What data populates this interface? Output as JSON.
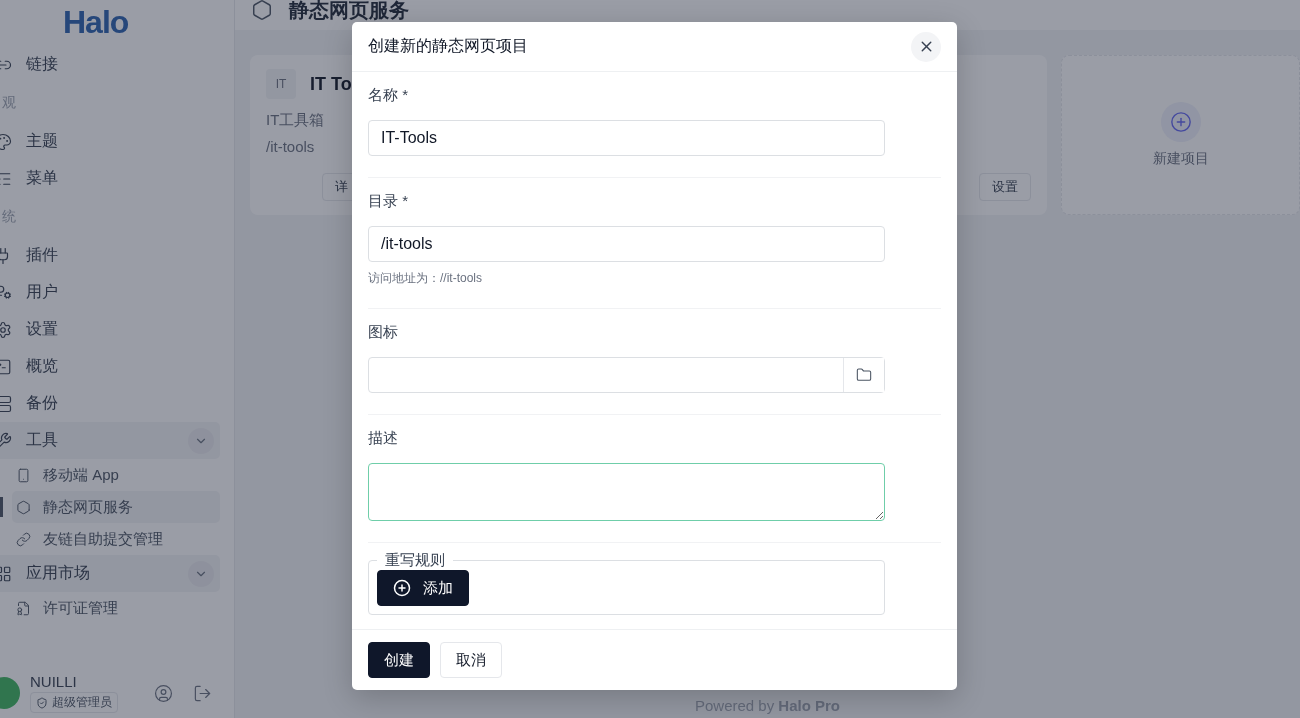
{
  "sidebar": {
    "logo": "Halo",
    "items": [
      {
        "kind": "item",
        "label": "链接"
      },
      {
        "kind": "group_label",
        "label": "观"
      },
      {
        "kind": "item",
        "label": "主题"
      },
      {
        "kind": "item",
        "label": "菜单"
      },
      {
        "kind": "group_label",
        "label": "统"
      },
      {
        "kind": "item",
        "label": "插件"
      },
      {
        "kind": "item",
        "label": "用户"
      },
      {
        "kind": "item",
        "label": "设置"
      },
      {
        "kind": "item",
        "label": "概览"
      },
      {
        "kind": "item",
        "label": "备份"
      },
      {
        "kind": "item",
        "label": "工具",
        "expanded": true,
        "children": [
          {
            "label": "移动端 App",
            "selected": false
          },
          {
            "label": "静态网页服务",
            "selected": true
          },
          {
            "label": "友链自助提交管理",
            "selected": false
          }
        ]
      },
      {
        "kind": "item",
        "label": "应用市场",
        "expanded": true,
        "children": [
          {
            "label": "许可证管理",
            "selected": false
          }
        ]
      }
    ],
    "user": {
      "name": "NUILLI",
      "role": "超级管理员"
    }
  },
  "page": {
    "title": "静态网页服务",
    "project_card": {
      "badge": "IT",
      "title": "IT To",
      "description": "IT工具箱",
      "path": "/it-tools",
      "buttons": [
        "详",
        "设置"
      ]
    },
    "new_card": {
      "label": "新建项目"
    },
    "footer": "Powered by **Halo Pro**"
  },
  "dialog": {
    "title": "创建新的静态网页项目",
    "fields": [
      {
        "kind": "text",
        "label": "名称 *",
        "value": "IT-Tools"
      },
      {
        "kind": "text",
        "label": "目录 *",
        "value": "/it-tools",
        "hint": "访问地址为：//it-tools"
      },
      {
        "kind": "file",
        "label": "图标"
      },
      {
        "kind": "textarea",
        "label": "描述",
        "focused": true
      },
      {
        "kind": "group",
        "label": "重写规则",
        "button": "添加"
      }
    ],
    "buttons": [
      {
        "label": "创建",
        "primary": true
      },
      {
        "label": "取消",
        "primary": false
      }
    ]
  }
}
